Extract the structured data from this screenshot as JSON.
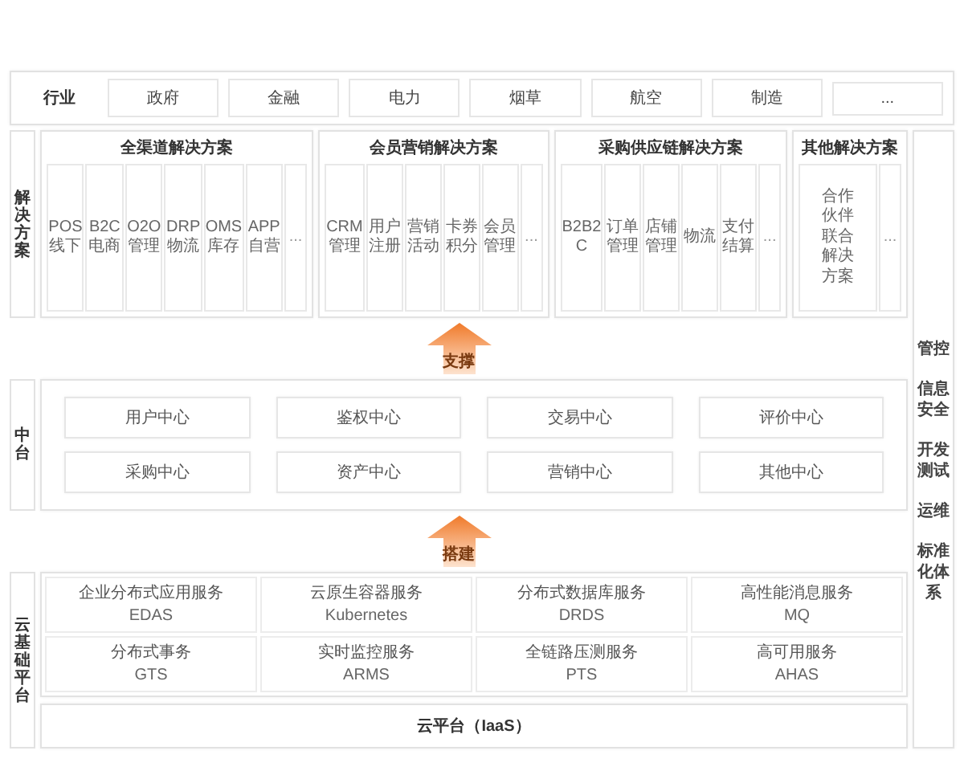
{
  "industry": {
    "label": "行业",
    "items": [
      "政府",
      "金融",
      "电力",
      "烟草",
      "航空",
      "制造",
      "..."
    ]
  },
  "solutions": {
    "label": "解决方案",
    "groups": [
      {
        "title": "全渠道解决方案",
        "items": [
          "POS\n线下",
          "B2C\n电商",
          "O2O\n管理",
          "DRP\n物流",
          "OMS\n库存",
          "APP\n自营",
          "..."
        ]
      },
      {
        "title": "会员营销解决方案",
        "items": [
          "CRM\n管理",
          "用户注册",
          "营销活动",
          "卡券积分",
          "会员管理",
          "..."
        ]
      },
      {
        "title": "采购供应链解决方案",
        "items": [
          "B2B2\nC",
          "订单管理",
          "店铺管理",
          "物流",
          "支付结算",
          "..."
        ]
      },
      {
        "title": "其他解决方案",
        "items": [
          "合作伙伴联合解决方案",
          "..."
        ]
      }
    ]
  },
  "support_arrow": {
    "label": "支撑"
  },
  "middle": {
    "label": "中台",
    "items": [
      "用户中心",
      "鉴权中心",
      "交易中心",
      "评价中心",
      "采购中心",
      "资产中心",
      "营销中心",
      "其他中心"
    ]
  },
  "build_arrow": {
    "label": "搭建"
  },
  "cloud": {
    "label": "云基础平台",
    "services": [
      {
        "name": "企业分布式应用服务",
        "code": "EDAS"
      },
      {
        "name": "云原生容器服务",
        "code": "Kubernetes"
      },
      {
        "name": "分布式数据库服务",
        "code": "DRDS"
      },
      {
        "name": "高性能消息服务",
        "code": "MQ"
      },
      {
        "name": "分布式事务",
        "code": "GTS"
      },
      {
        "name": "实时监控服务",
        "code": "ARMS"
      },
      {
        "name": "全链路压测服务",
        "code": "PTS"
      },
      {
        "name": "高可用服务",
        "code": "AHAS"
      }
    ],
    "platform": "云平台（IaaS）"
  },
  "side_column": {
    "items": [
      "管控",
      "信息安全",
      "开发测试",
      "运维",
      "标准化体系"
    ]
  }
}
